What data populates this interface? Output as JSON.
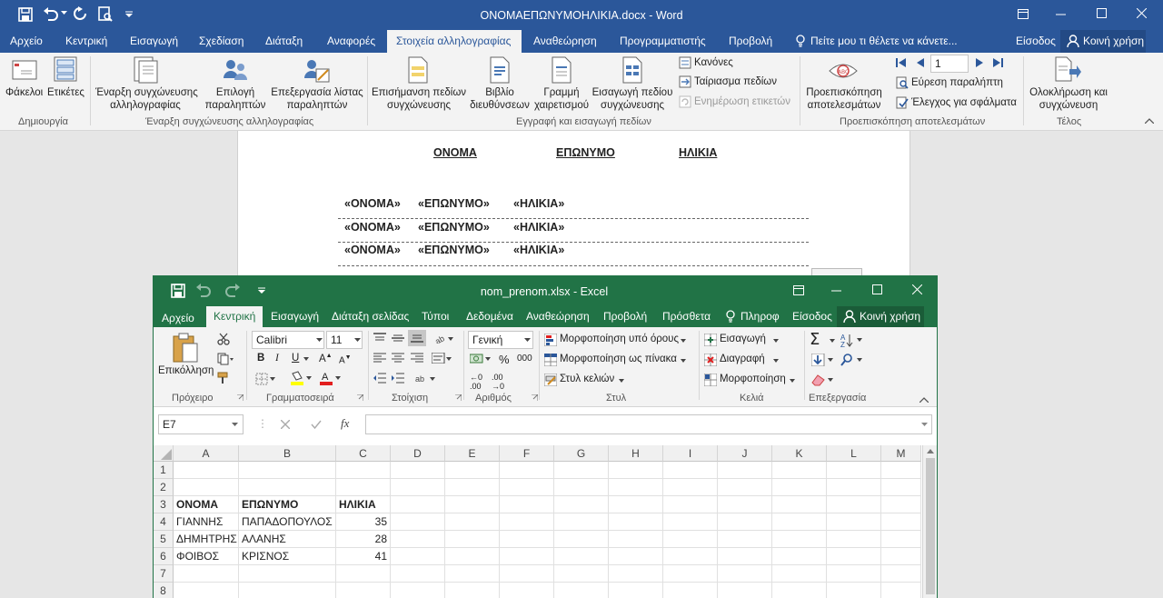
{
  "word": {
    "title": "ΟΝΟΜΑΕΠΩΝΥΜΟΗΛΙΚΙΑ.docx - Word",
    "tabs": [
      "Αρχείο",
      "Κεντρική",
      "Εισαγωγή",
      "Σχεδίαση",
      "Διάταξη",
      "Αναφορές",
      "Στοιχεία αλληλογραφίας",
      "Αναθεώρηση",
      "Προγραμματιστής",
      "Προβολή"
    ],
    "tell_me": "Πείτε μου τι θέλετε να κάνετε...",
    "signin": "Είσοδος",
    "share": "Κοινή χρήση",
    "ribbon": {
      "envelopes": "Φάκελοι",
      "labels": "Ετικέτες",
      "group_create": "Δημιουργία",
      "start_merge_1": "Έναρξη συγχώνευσης",
      "start_merge_2": "αλληλογραφίας",
      "select_recipients_1": "Επιλογή",
      "select_recipients_2": "παραληπτών",
      "edit_list_1": "Επεξεργασία λίστας",
      "edit_list_2": "παραληπτών",
      "group_start": "Έναρξη συγχώνευσης αλληλογραφίας",
      "highlight_1": "Επισήμανση πεδίων",
      "highlight_2": "συγχώνευσης",
      "address_block_1": "Βιβλίο",
      "address_block_2": "διευθύνσεων",
      "greeting_1": "Γραμμή",
      "greeting_2": "χαιρετισμού",
      "insert_field_1": "Εισαγωγή πεδίου",
      "insert_field_2": "συγχώνευσης",
      "rules": "Κανόνες",
      "match_fields": "Ταίριασμα πεδίων",
      "update_labels": "Ενημέρωση ετικετών",
      "group_write": "Εγγραφή και εισαγωγή πεδίων",
      "preview_1": "Προεπισκόπηση",
      "preview_2": "αποτελεσμάτων",
      "record_number": "1",
      "find_recipient": "Εύρεση παραλήπτη",
      "check_errors": "Έλεγχος για σφάλματα",
      "group_preview": "Προεπισκόπηση αποτελεσμάτων",
      "finish_1": "Ολοκλήρωση και",
      "finish_2": "συγχώνευση",
      "group_finish": "Τέλος"
    },
    "doc": {
      "headers": [
        "ΟΝΟΜΑ",
        "ΕΠΩΝΥΜΟ",
        "ΗΛΙΚΙΑ"
      ],
      "rows": [
        [
          "«ΟΝΟΜΑ»",
          "«ΕΠΩΝΥΜΟ»",
          "«ΗΛΙΚΙΑ»"
        ],
        [
          "«ΟΝΟΜΑ»",
          "«ΕΠΩΝΥΜΟ»",
          "«ΗΛΙΚΙΑ»"
        ],
        [
          "«ΟΝΟΜΑ»",
          "«ΕΠΩΝΥΜΟ»",
          "«ΗΛΙΚΙΑ»"
        ]
      ]
    }
  },
  "excel": {
    "title": "nom_prenom.xlsx - Excel",
    "tabs": [
      "Αρχείο",
      "Κεντρική",
      "Εισαγωγή",
      "Διάταξη σελίδας",
      "Τύποι",
      "Δεδομένα",
      "Αναθεώρηση",
      "Προβολή",
      "Πρόσθετα"
    ],
    "tell_me": "Πληροφ",
    "signin": "Είσοδος",
    "share": "Κοινή χρήση",
    "ribbon": {
      "paste": "Επικόλληση",
      "group_clipboard": "Πρόχειρο",
      "font_name": "Calibri",
      "font_size": "11",
      "group_font": "Γραμματοσειρά",
      "group_align": "Στοίχιση",
      "number_format": "Γενική",
      "group_number": "Αριθμός",
      "cond_format": "Μορφοποίηση υπό όρους",
      "format_table": "Μορφοποίηση ως πίνακα",
      "cell_styles": "Στυλ κελιών",
      "group_styles": "Στυλ",
      "insert": "Εισαγωγή",
      "delete": "Διαγραφή",
      "format": "Μορφοποίηση",
      "group_cells": "Κελιά",
      "group_edit": "Επεξεργασία"
    },
    "name_box": "E7",
    "formula": "",
    "columns": [
      "A",
      "B",
      "C",
      "D",
      "E",
      "F",
      "G",
      "H",
      "I",
      "J",
      "K",
      "L",
      "M"
    ],
    "row_numbers": [
      "1",
      "2",
      "3",
      "4",
      "5",
      "6",
      "7",
      "8"
    ],
    "cells": {
      "A3": "ΟΝΟΜΑ",
      "B3": "ΕΠΩΝΥΜΟ",
      "C3": "ΗΛΙΚΙΑ",
      "A4": "ΓΙΑΝΝΗΣ",
      "B4": "ΠΑΠΑΔΟΠΟΥΛΟΣ",
      "C4": "35",
      "A5": "ΔΗΜΗΤΡΗΣ",
      "B5": "ΑΛΑΝΗΣ",
      "C5": "28",
      "A6": "ΦΟΙΒΟΣ",
      "B6": "ΚΡΙΣΝΟΣ",
      "C6": "41"
    }
  }
}
